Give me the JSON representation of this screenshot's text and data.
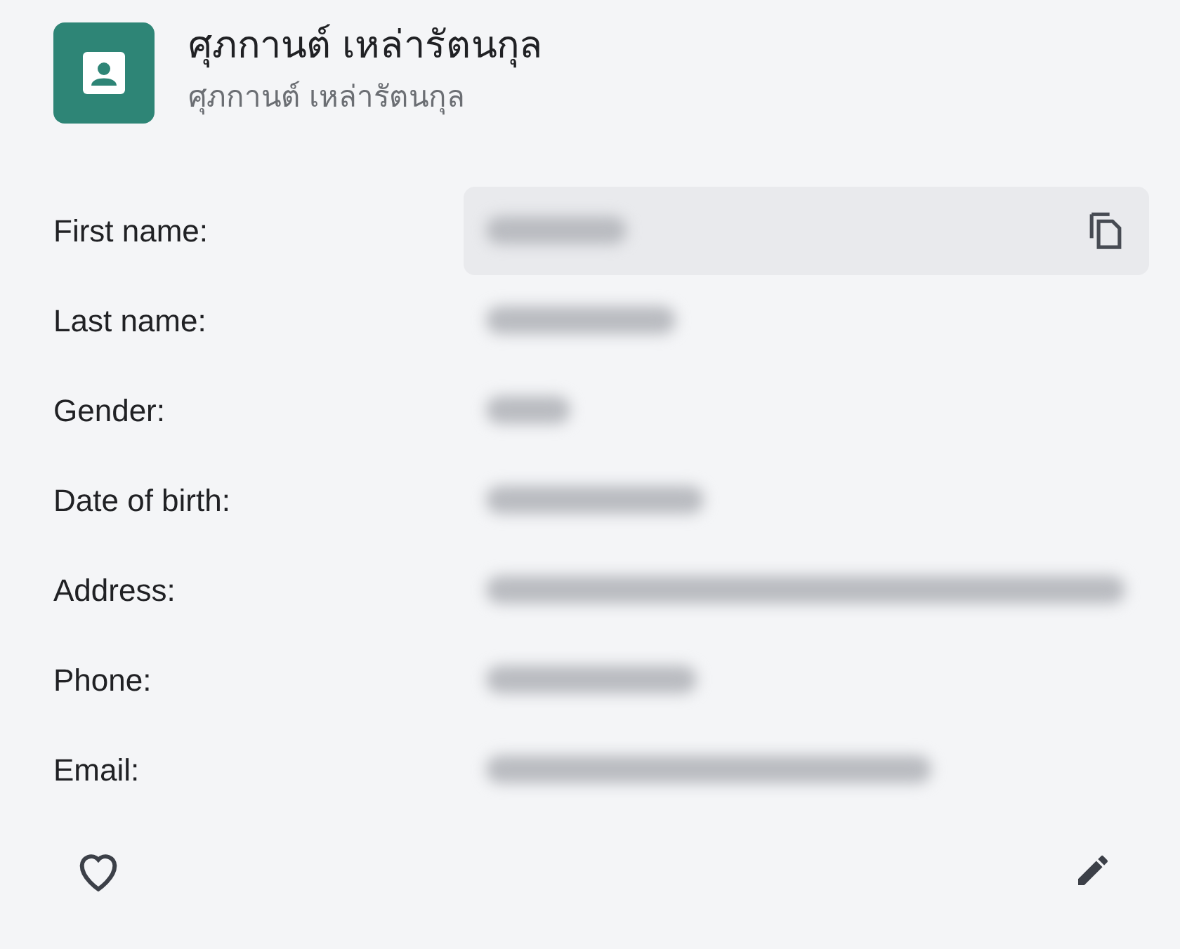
{
  "contact": {
    "name": "ศุภกานต์ เหล่ารัตนกุล",
    "subtitle": "ศุภกานต์ เหล่ารัตนกุล"
  },
  "fields": [
    {
      "label": "First name:",
      "redacted": true,
      "hovered": true
    },
    {
      "label": "Last name:",
      "redacted": true,
      "hovered": false
    },
    {
      "label": "Gender:",
      "redacted": true,
      "hovered": false
    },
    {
      "label": "Date of birth:",
      "redacted": true,
      "hovered": false
    },
    {
      "label": "Address:",
      "redacted": true,
      "hovered": false
    },
    {
      "label": "Phone:",
      "redacted": true,
      "hovered": false
    },
    {
      "label": "Email:",
      "redacted": true,
      "hovered": false
    }
  ],
  "favorite": false
}
